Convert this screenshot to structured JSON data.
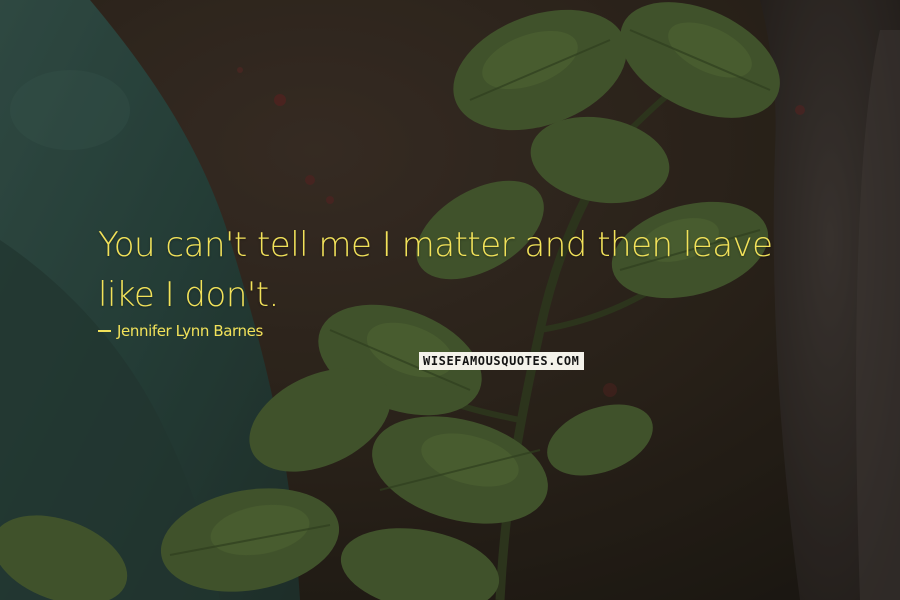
{
  "quote": {
    "text": "You can't tell me I matter and then leave like I don't."
  },
  "author": {
    "name": "Jennifer Lynn Barnes"
  },
  "watermark": {
    "brand": "WISEFAMOUSQUOTES.COM"
  },
  "colors": {
    "text": "#f2e25a",
    "brand_bg": "#f4f2ea",
    "brand_text": "#141414"
  }
}
